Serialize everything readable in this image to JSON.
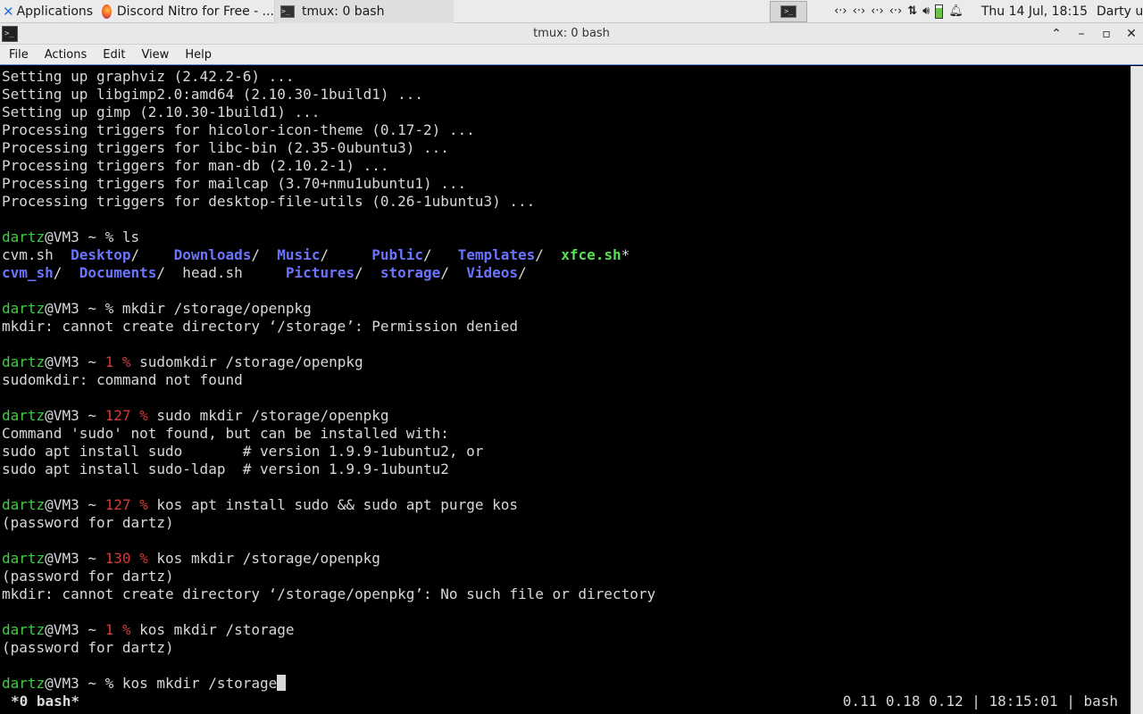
{
  "panel": {
    "applications_label": "Applications",
    "tasks": [
      {
        "label": "Discord Nitro for Free - ..."
      },
      {
        "label": "tmux: 0 bash"
      }
    ],
    "clock": "Thu 14 Jul, 18:15",
    "user": "Darty uwu"
  },
  "window": {
    "title": "tmux: 0 bash"
  },
  "menubar": {
    "items": [
      "File",
      "Actions",
      "Edit",
      "View",
      "Help"
    ]
  },
  "terminal": {
    "lines": [
      {
        "segments": [
          {
            "t": "Setting up graphviz (2.42.2-6) ...",
            "c": ""
          }
        ]
      },
      {
        "segments": [
          {
            "t": "Setting up libgimp2.0:amd64 (2.10.30-1build1) ...",
            "c": ""
          }
        ]
      },
      {
        "segments": [
          {
            "t": "Setting up gimp (2.10.30-1build1) ...",
            "c": ""
          }
        ]
      },
      {
        "segments": [
          {
            "t": "Processing triggers for hicolor-icon-theme (0.17-2) ...",
            "c": ""
          }
        ]
      },
      {
        "segments": [
          {
            "t": "Processing triggers for libc-bin (2.35-0ubuntu3) ...",
            "c": ""
          }
        ]
      },
      {
        "segments": [
          {
            "t": "Processing triggers for man-db (2.10.2-1) ...",
            "c": ""
          }
        ]
      },
      {
        "segments": [
          {
            "t": "Processing triggers for mailcap (3.70+nmu1ubuntu1) ...",
            "c": ""
          }
        ]
      },
      {
        "segments": [
          {
            "t": "Processing triggers for desktop-file-utils (0.26-1ubuntu3) ...",
            "c": ""
          }
        ]
      },
      {
        "segments": [
          {
            "t": "",
            "c": ""
          }
        ]
      },
      {
        "segments": [
          {
            "t": "dartz",
            "c": "green"
          },
          {
            "t": "@VM3 ~ % ls",
            "c": ""
          }
        ]
      },
      {
        "segments": [
          {
            "t": "cvm.sh  ",
            "c": ""
          },
          {
            "t": "Desktop",
            "c": "blue"
          },
          {
            "t": "/    ",
            "c": ""
          },
          {
            "t": "Downloads",
            "c": "blue"
          },
          {
            "t": "/  ",
            "c": ""
          },
          {
            "t": "Music",
            "c": "blue"
          },
          {
            "t": "/     ",
            "c": ""
          },
          {
            "t": "Public",
            "c": "blue"
          },
          {
            "t": "/   ",
            "c": ""
          },
          {
            "t": "Templates",
            "c": "blue"
          },
          {
            "t": "/  ",
            "c": ""
          },
          {
            "t": "xfce.sh",
            "c": "exec"
          },
          {
            "t": "*",
            "c": ""
          }
        ]
      },
      {
        "segments": [
          {
            "t": "cvm_sh",
            "c": "blue"
          },
          {
            "t": "/  ",
            "c": ""
          },
          {
            "t": "Documents",
            "c": "blue"
          },
          {
            "t": "/  head.sh     ",
            "c": ""
          },
          {
            "t": "Pictures",
            "c": "blue"
          },
          {
            "t": "/  ",
            "c": ""
          },
          {
            "t": "storage",
            "c": "blue"
          },
          {
            "t": "/  ",
            "c": ""
          },
          {
            "t": "Videos",
            "c": "blue"
          },
          {
            "t": "/",
            "c": ""
          }
        ]
      },
      {
        "segments": [
          {
            "t": "",
            "c": ""
          }
        ]
      },
      {
        "segments": [
          {
            "t": "dartz",
            "c": "green"
          },
          {
            "t": "@VM3 ~ % mkdir /storage/openpkg",
            "c": ""
          }
        ]
      },
      {
        "segments": [
          {
            "t": "mkdir: cannot create directory ‘/storage’: Permission denied",
            "c": ""
          }
        ]
      },
      {
        "segments": [
          {
            "t": "",
            "c": ""
          }
        ]
      },
      {
        "segments": [
          {
            "t": "dartz",
            "c": "green"
          },
          {
            "t": "@VM3 ~ ",
            "c": ""
          },
          {
            "t": "1 %",
            "c": "red"
          },
          {
            "t": " sudomkdir /storage/openpkg",
            "c": ""
          }
        ]
      },
      {
        "segments": [
          {
            "t": "sudomkdir: command not found",
            "c": ""
          }
        ]
      },
      {
        "segments": [
          {
            "t": "",
            "c": ""
          }
        ]
      },
      {
        "segments": [
          {
            "t": "dartz",
            "c": "green"
          },
          {
            "t": "@VM3 ~ ",
            "c": ""
          },
          {
            "t": "127 %",
            "c": "red"
          },
          {
            "t": " sudo mkdir /storage/openpkg",
            "c": ""
          }
        ]
      },
      {
        "segments": [
          {
            "t": "Command 'sudo' not found, but can be installed with:",
            "c": ""
          }
        ]
      },
      {
        "segments": [
          {
            "t": "sudo apt install sudo       # version 1.9.9-1ubuntu2, or",
            "c": ""
          }
        ]
      },
      {
        "segments": [
          {
            "t": "sudo apt install sudo-ldap  # version 1.9.9-1ubuntu2",
            "c": ""
          }
        ]
      },
      {
        "segments": [
          {
            "t": "",
            "c": ""
          }
        ]
      },
      {
        "segments": [
          {
            "t": "dartz",
            "c": "green"
          },
          {
            "t": "@VM3 ~ ",
            "c": ""
          },
          {
            "t": "127 %",
            "c": "red"
          },
          {
            "t": " kos apt install sudo && sudo apt purge kos",
            "c": ""
          }
        ]
      },
      {
        "segments": [
          {
            "t": "(password for dartz)",
            "c": ""
          }
        ]
      },
      {
        "segments": [
          {
            "t": "",
            "c": ""
          }
        ]
      },
      {
        "segments": [
          {
            "t": "dartz",
            "c": "green"
          },
          {
            "t": "@VM3 ~ ",
            "c": ""
          },
          {
            "t": "130 %",
            "c": "red"
          },
          {
            "t": " kos mkdir /storage/openpkg",
            "c": ""
          }
        ]
      },
      {
        "segments": [
          {
            "t": "(password for dartz)",
            "c": ""
          }
        ]
      },
      {
        "segments": [
          {
            "t": "mkdir: cannot create directory ‘/storage/openpkg’: No such file or directory",
            "c": ""
          }
        ]
      },
      {
        "segments": [
          {
            "t": "",
            "c": ""
          }
        ]
      },
      {
        "segments": [
          {
            "t": "dartz",
            "c": "green"
          },
          {
            "t": "@VM3 ~ ",
            "c": ""
          },
          {
            "t": "1 %",
            "c": "red"
          },
          {
            "t": " kos mkdir /storage",
            "c": ""
          }
        ]
      },
      {
        "segments": [
          {
            "t": "(password for dartz)",
            "c": ""
          }
        ]
      },
      {
        "segments": [
          {
            "t": "",
            "c": ""
          }
        ]
      }
    ],
    "prompt": {
      "user": "dartz",
      "rest": "@VM3 ~ % ",
      "input": "kos mkdir /storage"
    }
  },
  "tmux_status": {
    "left": "*0 bash*",
    "right": "0.11 0.18 0.12 | 18:15:01 | bash"
  }
}
